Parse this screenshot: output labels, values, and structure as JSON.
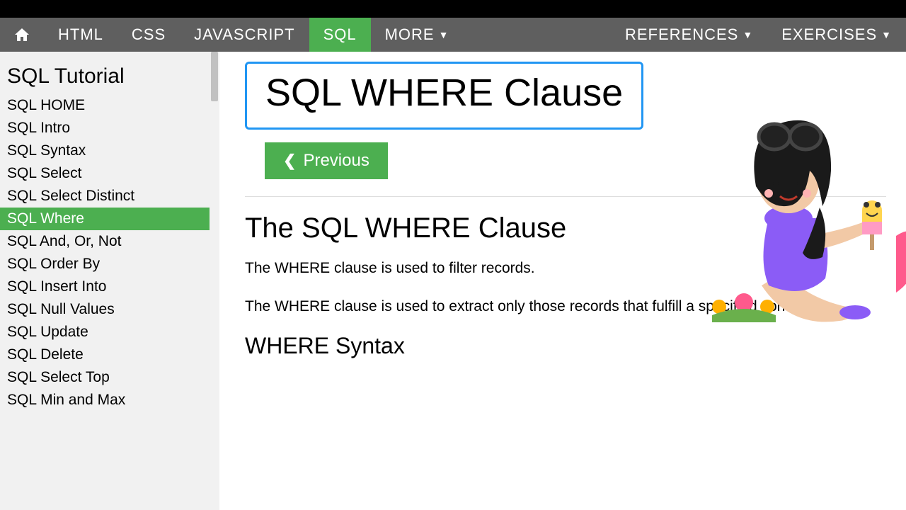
{
  "nav": {
    "items": [
      "HTML",
      "CSS",
      "JAVASCRIPT",
      "SQL",
      "MORE"
    ],
    "active": "SQL",
    "right": [
      "REFERENCES",
      "EXERCISES"
    ]
  },
  "sidebar": {
    "heading": "SQL Tutorial",
    "items": [
      "SQL HOME",
      "SQL Intro",
      "SQL Syntax",
      "SQL Select",
      "SQL Select Distinct",
      "SQL Where",
      "SQL And, Or, Not",
      "SQL Order By",
      "SQL Insert Into",
      "SQL Null Values",
      "SQL Update",
      "SQL Delete",
      "SQL Select Top",
      "SQL Min and Max"
    ],
    "active": "SQL Where"
  },
  "content": {
    "title": "SQL WHERE Clause",
    "prev_label": "Previous",
    "h2": "The SQL WHERE Clause",
    "p1": "The WHERE clause is used to filter records.",
    "p2": "The WHERE clause is used to extract only those records that fulfill a specified condition.",
    "h3": "WHERE Syntax"
  },
  "colors": {
    "accent": "#4CAF50",
    "highlight": "#2196F3",
    "navbg": "#5f5f5f"
  }
}
